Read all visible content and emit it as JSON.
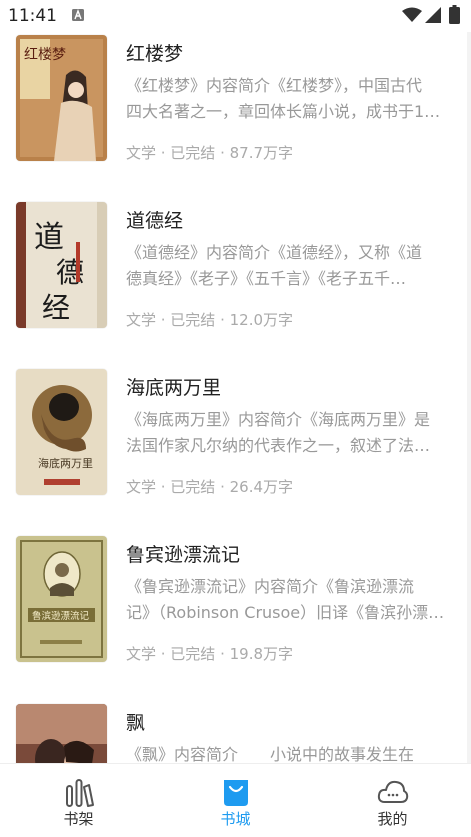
{
  "status_bar": {
    "time": "11:41"
  },
  "books": [
    {
      "title": "红楼梦",
      "desc_lines": [
        "《红楼梦》内容简介《红楼梦》，中国古代",
        "四大名著之一，章回体长篇小说，成书于1…"
      ],
      "meta": "文学 · 已完结 · 87.7万字",
      "cover_text": "红楼梦"
    },
    {
      "title": "道德经",
      "desc_lines": [
        "《道德经》内容简介《道德经》，又称《道",
        "德真经》《老子》《五千言》《老子五千…"
      ],
      "meta": "文学 · 已完结 · 12.0万字",
      "cover_text": "道德经"
    },
    {
      "title": "海底两万里",
      "desc_lines": [
        "《海底两万里》内容简介《海底两万里》是",
        "法国作家凡尔纳的代表作之一，叙述了法…"
      ],
      "meta": "文学 · 已完结 · 26.4万字",
      "cover_text": "海底两万里"
    },
    {
      "title": "鲁宾逊漂流记",
      "desc_lines": [
        "《鲁宾逊漂流记》内容简介《鲁滨逊漂流",
        "记》（Robinson Crusoe）旧译《鲁滨孙漂…"
      ],
      "meta": "文学 · 已完结 · 19.8万字",
      "cover_text": "鲁滨逊漂流记"
    },
    {
      "title": "飘",
      "desc_lines": [
        "《飘》内容简介　　小说中的故事发生在",
        ""
      ],
      "meta": "",
      "cover_text": ""
    }
  ],
  "tabs": [
    {
      "label": "书架",
      "icon": "bookshelf-icon",
      "active": false
    },
    {
      "label": "书城",
      "icon": "shopping-bag-icon",
      "active": true
    },
    {
      "label": "我的",
      "icon": "cloud-icon",
      "active": false
    }
  ],
  "colors": {
    "accent": "#1e9bf0",
    "inactive": "#333333",
    "desc": "#999999"
  }
}
